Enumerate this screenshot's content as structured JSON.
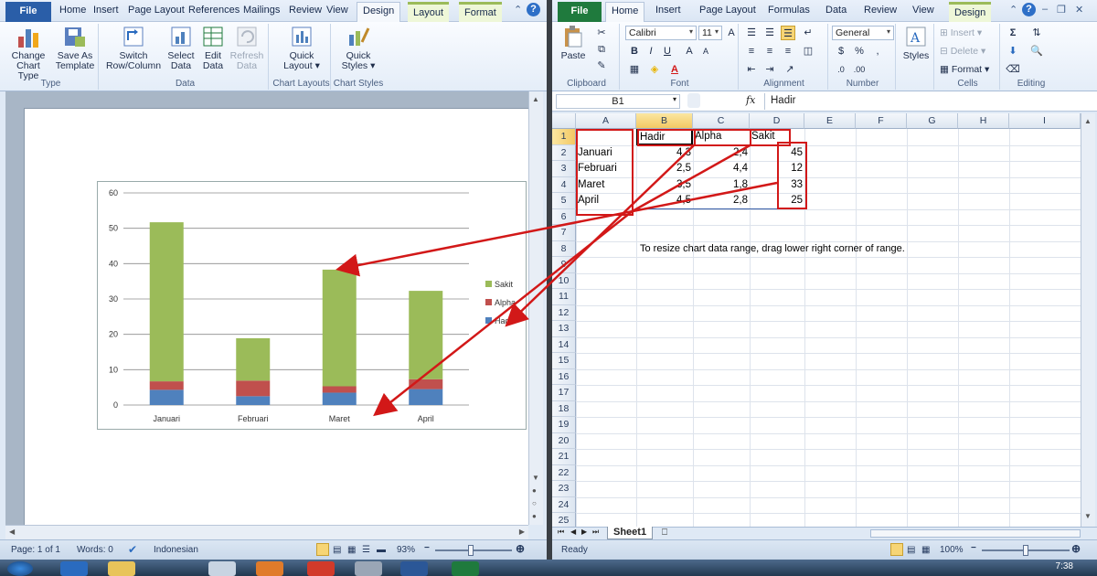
{
  "word": {
    "tabs": [
      "File",
      "Home",
      "Insert",
      "Page Layout",
      "References",
      "Mailings",
      "Review",
      "View",
      "Design",
      "Layout",
      "Format"
    ],
    "active_tab": "Design",
    "ribbon": {
      "change_chart_type": "Change Chart Type",
      "save_as_template": "Save As Template",
      "group_type": "Type",
      "switch_row_column": "Switch Row/Column",
      "select_data": "Select Data",
      "edit_data": "Edit Data",
      "refresh_data": "Refresh Data",
      "group_data": "Data",
      "quick_layout": "Quick Layout",
      "group_chart_layouts": "Chart Layouts",
      "quick_styles": "Quick Styles",
      "group_chart_styles": "Chart Styles"
    },
    "status": {
      "page": "Page: 1 of 1",
      "words": "Words: 0",
      "language": "Indonesian",
      "zoom": "93%"
    }
  },
  "chart_data": {
    "type": "bar",
    "stacked": true,
    "categories": [
      "Januari",
      "Februari",
      "Maret",
      "April"
    ],
    "series": [
      {
        "name": "Hadir",
        "values": [
          4.3,
          2.5,
          3.5,
          4.5
        ],
        "color": "#4f81bd"
      },
      {
        "name": "Alpha",
        "values": [
          2.4,
          4.4,
          1.8,
          2.8
        ],
        "color": "#c0504d"
      },
      {
        "name": "Sakit",
        "values": [
          45,
          12,
          33,
          25
        ],
        "color": "#9bbb59"
      }
    ],
    "ylim": [
      0,
      60
    ],
    "yticks": [
      "0",
      "10",
      "20",
      "30",
      "40",
      "50",
      "60"
    ],
    "grid": true,
    "legend": "right"
  },
  "excel": {
    "tabs": [
      "File",
      "Home",
      "Insert",
      "Page Layout",
      "Formulas",
      "Data",
      "Review",
      "View",
      "Design"
    ],
    "active_tab": "Home",
    "ribbon": {
      "paste": "Paste",
      "group_clipboard": "Clipboard",
      "font_name": "Calibri",
      "font_size": "11",
      "group_font": "Font",
      "group_alignment": "Alignment",
      "number_format": "General",
      "group_number": "Number",
      "styles": "Styles",
      "insert": "Insert",
      "delete": "Delete",
      "format": "Format",
      "group_cells": "Cells",
      "group_editing": "Editing"
    },
    "name_box": "B1",
    "fx": "fx",
    "formula": "Hadir",
    "columns": [
      "A",
      "B",
      "C",
      "D",
      "E",
      "F",
      "G",
      "H",
      "I"
    ],
    "rows": [
      "1",
      "2",
      "3",
      "4",
      "5",
      "6",
      "7",
      "8",
      "9",
      "10",
      "11",
      "12",
      "13",
      "14",
      "15",
      "16",
      "17",
      "18",
      "19",
      "20",
      "21",
      "22",
      "23",
      "24",
      "25"
    ],
    "cells": {
      "B1": "Hadir",
      "C1": "Alpha",
      "D1": "Sakit",
      "A2": "Januari",
      "B2": "4,3",
      "C2": "2,4",
      "D2": "45",
      "A3": "Februari",
      "B3": "2,5",
      "C3": "4,4",
      "D3": "12",
      "A4": "Maret",
      "B4": "3,5",
      "C4": "1,8",
      "D4": "33",
      "A5": "April",
      "B5": "4,5",
      "C5": "2,8",
      "D5": "25"
    },
    "note": "To resize chart data range, drag lower right corner of range.",
    "sheet_tab": "Sheet1",
    "status": {
      "ready": "Ready",
      "zoom": "100%"
    }
  },
  "taskbar": {
    "time": "7:38"
  }
}
